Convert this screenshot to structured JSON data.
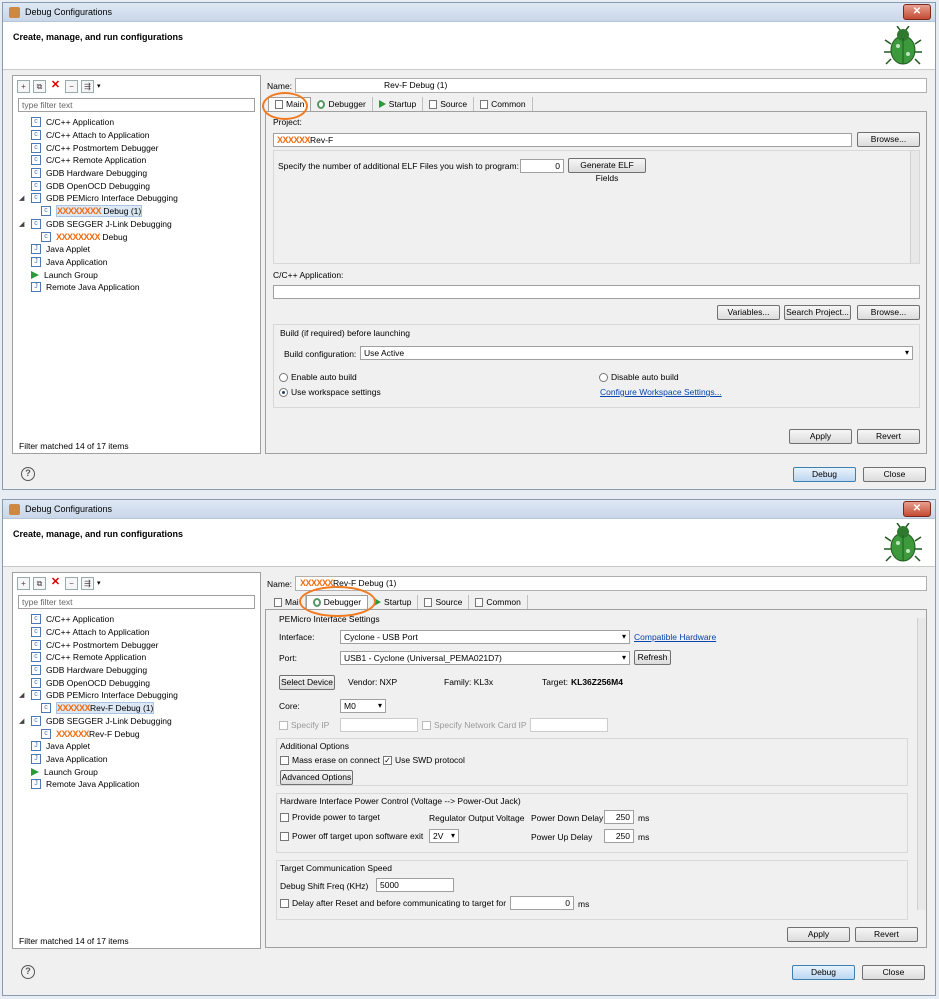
{
  "title": "Debug Configurations",
  "header": "Create, manage, and run configurations",
  "filter_placeholder": "type filter text",
  "filter_status": "Filter matched 14 of 17 items",
  "tree": [
    {
      "label": "C/C++ Application"
    },
    {
      "label": "C/C++ Attach to Application"
    },
    {
      "label": "C/C++ Postmortem Debugger"
    },
    {
      "label": "C/C++ Remote Application"
    },
    {
      "label": "GDB Hardware Debugging"
    },
    {
      "label": "GDB OpenOCD Debugging"
    },
    {
      "label": "GDB PEMicro Interface Debugging"
    },
    {
      "label": "GDB SEGGER J-Link Debugging"
    },
    {
      "label": "Java Applet"
    },
    {
      "label": "Java Application"
    },
    {
      "label": "Launch Group"
    },
    {
      "label": "Remote Java Application"
    }
  ],
  "redact1": "XXXXXXXX",
  "redact2": "XXXXXX",
  "top": {
    "child1": "Debug (1)",
    "child2": "Debug",
    "name_value": "Rev-F Debug (1)",
    "project_value": "Rev-F"
  },
  "bottom": {
    "child1": "Rev-F Debug (1)",
    "child2": "Rev-F Debug",
    "name_value": "Rev-F Debug (1)"
  },
  "name_label": "Name:",
  "tabs": [
    "Main",
    "Debugger",
    "Startup",
    "Source",
    "Common"
  ],
  "tab_bottom_main": "Mai",
  "main": {
    "project_label": "Project:",
    "browse": "Browse...",
    "elf_label": "Specify the number of additional ELF Files you wish to program:",
    "elf_value": "0",
    "elf_button": "Generate ELF Fields",
    "app_label": "C/C++ Application:",
    "variables": "Variables...",
    "search_project": "Search Project...",
    "build_group": "Build (if required) before launching",
    "build_config_label": "Build configuration:",
    "build_config_value": "Use Active",
    "enable_auto": "Enable auto build",
    "disable_auto": "Disable auto build",
    "use_workspace": "Use workspace settings",
    "configure_ws": "Configure Workspace Settings..."
  },
  "debugger": {
    "pemicro_settings": "PEMicro Interface Settings",
    "interface_label": "Interface:",
    "interface_value": "Cyclone - USB Port",
    "compatible_hw": "Compatible Hardware",
    "port_label": "Port:",
    "port_value": "USB1 - Cyclone (Universal_PEMA021D7)",
    "refresh": "Refresh",
    "select_device": "Select Device",
    "vendor": "Vendor:  NXP",
    "family": "Family:  KL3x",
    "target_label": "Target:",
    "target_value": "KL36Z256M4",
    "core_label": "Core:",
    "core_value": "M0",
    "specify_ip": "Specify IP",
    "specify_nc": "Specify Network Card IP",
    "additional": "Additional Options",
    "mass_erase": "Mass erase on connect",
    "use_swd": "Use SWD protocol",
    "advanced": "Advanced Options",
    "hw_power": "Hardware Interface Power Control (Voltage --> Power-Out Jack)",
    "provide_power": "Provide power to target",
    "reg_voltage": "Regulator Output Voltage",
    "pd_delay": "Power Down Delay",
    "pd_value": "250",
    "ms": "ms",
    "power_off": "Power off target upon software exit",
    "volt_value": "2V",
    "pu_delay": "Power Up Delay",
    "pu_value": "250",
    "comm_speed": "Target Communication Speed",
    "shift_freq": "Debug Shift Freq (KHz)",
    "shift_value": "5000",
    "delay_reset": "Delay after Reset and before communicating to target for",
    "delay_value": "0"
  },
  "apply": "Apply",
  "revert": "Revert",
  "debug": "Debug",
  "close": "Close",
  "help": "?"
}
